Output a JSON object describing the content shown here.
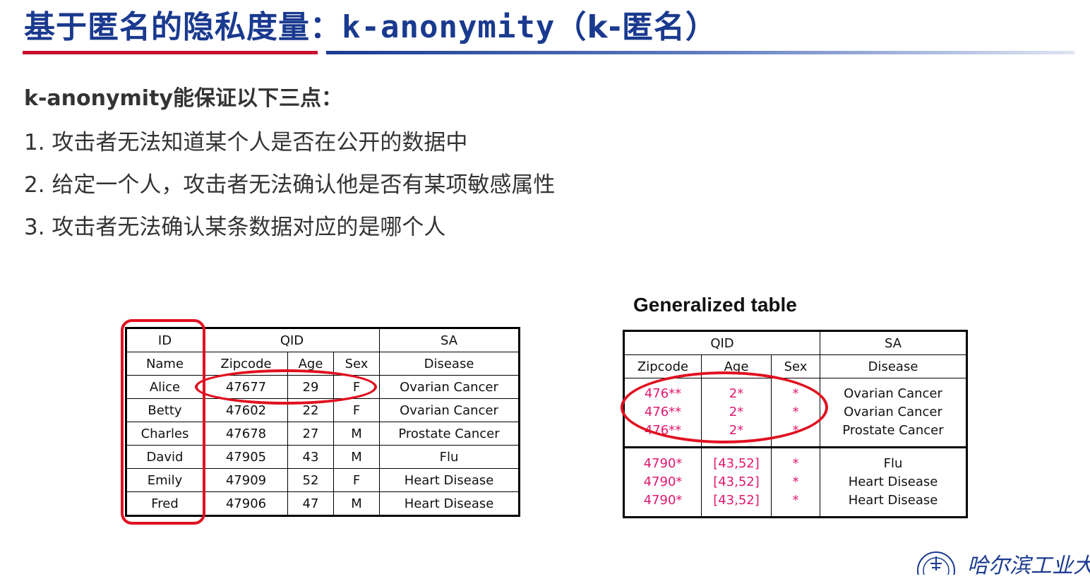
{
  "title": {
    "cn": "基于匿名的隐私度量：",
    "mono": "k-anonymity",
    "tail": "（k-匿名）"
  },
  "intro": "k-anonymity能保证以下三点：",
  "points": [
    "1.  攻击者无法知道某个人是否在公开的数据中",
    "2.  给定一个人，攻击者无法确认他是否有某项敏感属性",
    "3. 攻击者无法确认某条数据对应的是哪个人"
  ],
  "original_table": {
    "header_top": [
      "ID",
      "QID",
      "SA"
    ],
    "header_sub": [
      "Name",
      "Zipcode",
      "Age",
      "Sex",
      "Disease"
    ],
    "rows": [
      [
        "Alice",
        "47677",
        "29",
        "F",
        "Ovarian Cancer"
      ],
      [
        "Betty",
        "47602",
        "22",
        "F",
        "Ovarian Cancer"
      ],
      [
        "Charles",
        "47678",
        "27",
        "M",
        "Prostate Cancer"
      ],
      [
        "David",
        "47905",
        "43",
        "M",
        "Flu"
      ],
      [
        "Emily",
        "47909",
        "52",
        "F",
        "Heart Disease"
      ],
      [
        "Fred",
        "47906",
        "47",
        "M",
        "Heart Disease"
      ]
    ]
  },
  "generalized_table": {
    "title": "Generalized table",
    "header_top": [
      "QID",
      "SA"
    ],
    "header_sub": [
      "Zipcode",
      "Age",
      "Sex",
      "Disease"
    ],
    "groups": [
      {
        "zip": [
          "476**",
          "476**",
          "476**"
        ],
        "age": [
          "2*",
          "2*",
          "2*"
        ],
        "sex": [
          "*",
          "*",
          "*"
        ],
        "disease": [
          "Ovarian Cancer",
          "Ovarian Cancer",
          "Prostate Cancer"
        ]
      },
      {
        "zip": [
          "4790*",
          "4790*",
          "4790*"
        ],
        "age": [
          "[43,52]",
          "[43,52]",
          "[43,52]"
        ],
        "sex": [
          "*",
          "*",
          "*"
        ],
        "disease": [
          "Flu",
          "Heart Disease",
          "Heart Disease"
        ]
      }
    ]
  },
  "colors": {
    "title": "#1a3a8f",
    "accent_red": "#c8102e",
    "highlight": "#e01020",
    "generalized_value": "#e0186f"
  },
  "logo": {
    "icon": "university-seal-icon",
    "text": "哈尔滨工业大学"
  }
}
